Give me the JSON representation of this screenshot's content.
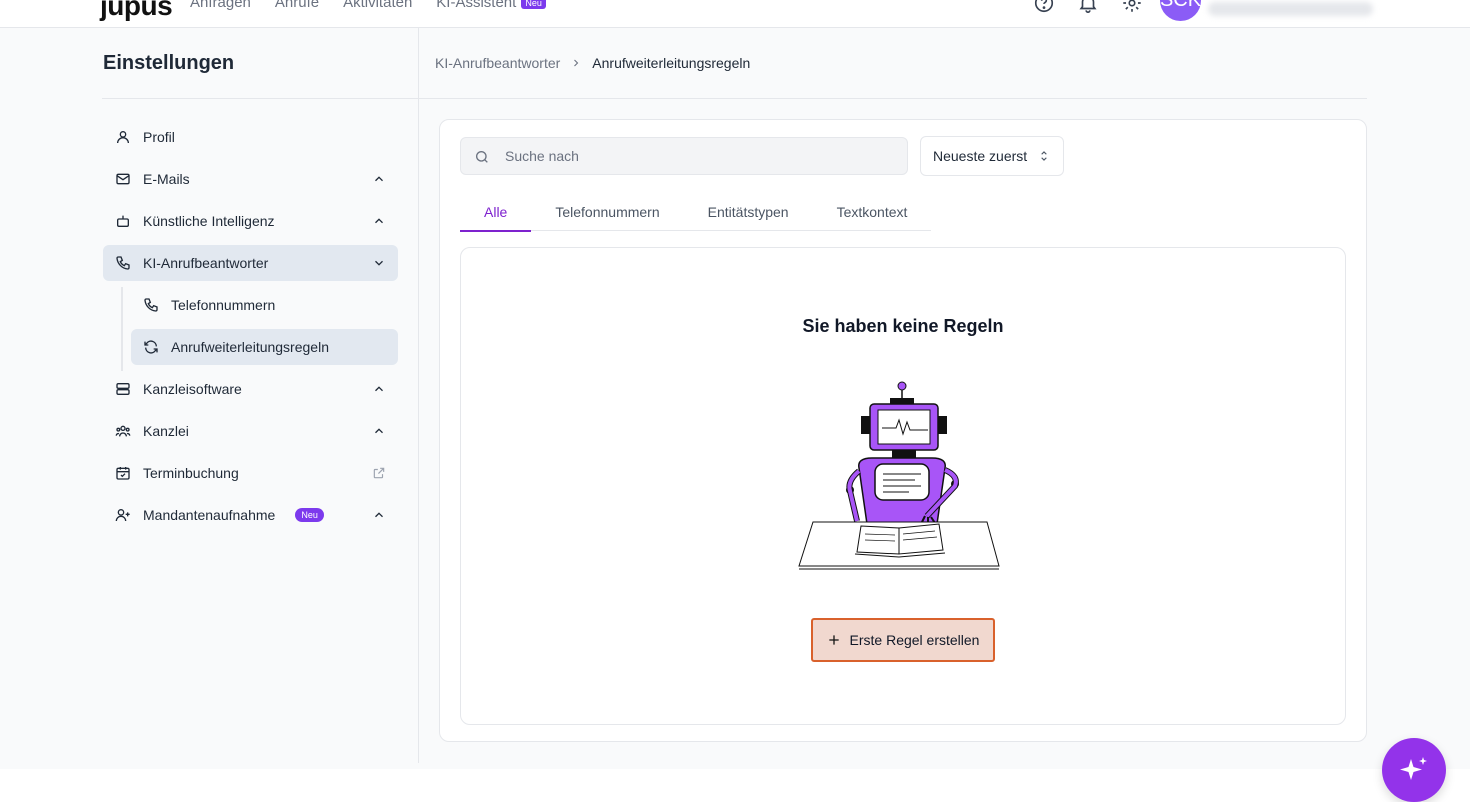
{
  "topbar": {
    "logo": "jupus",
    "nav": [
      "Anfragen",
      "Anrufe",
      "Aktivitäten",
      "KI-Assistent"
    ],
    "new_badge": "Neu",
    "avatar_initials": "SCK"
  },
  "sidebar": {
    "title": "Einstellungen",
    "items": [
      {
        "label": "Profil",
        "icon": "user-icon"
      },
      {
        "label": "E-Mails",
        "icon": "mail-icon"
      },
      {
        "label": "Künstliche Intelligenz",
        "icon": "bot-icon"
      },
      {
        "label": "KI-Anrufbeantworter",
        "icon": "phone-icon"
      },
      {
        "label": "Kanzleisoftware",
        "icon": "server-icon"
      },
      {
        "label": "Kanzlei",
        "icon": "users-icon"
      },
      {
        "label": "Terminbuchung",
        "icon": "calendar-check-icon"
      },
      {
        "label": "Mandantenaufnahme",
        "icon": "user-plus-icon",
        "badge": "Neu"
      }
    ],
    "subitems": [
      {
        "label": "Telefonnummern",
        "icon": "phone-icon"
      },
      {
        "label": "Anrufweiterleitungsregeln",
        "icon": "refresh-icon"
      }
    ]
  },
  "breadcrumb": {
    "parent": "KI-Anrufbeantworter",
    "current": "Anrufweiterleitungsregeln"
  },
  "search": {
    "placeholder": "Suche nach",
    "value": ""
  },
  "sort": {
    "selected": "Neueste zuerst"
  },
  "tabs": [
    {
      "label": "Alle",
      "active": true
    },
    {
      "label": "Telefonnummern"
    },
    {
      "label": "Entitätstypen"
    },
    {
      "label": "Textkontext"
    }
  ],
  "empty_state": {
    "title": "Sie haben keine Regeln",
    "button_label": "Erste Regel erstellen"
  },
  "colors": {
    "accent": "#7e22ce",
    "button_bg": "#f1d8cf",
    "button_border": "#d9612c",
    "fab": "#9333ea"
  }
}
